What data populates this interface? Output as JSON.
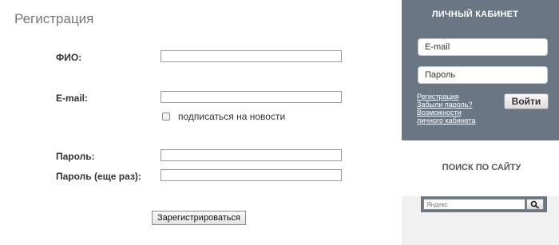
{
  "page": {
    "title": "Регистрация"
  },
  "form": {
    "fio_label": "ФИО:",
    "email_label": "E-mail:",
    "subscribe_label": "подписаться на новости",
    "password_label": "Пароль:",
    "password_repeat_label": "Пароль (еще раз):",
    "submit_label": "Зарегистрироваться"
  },
  "cabinet": {
    "title": "ЛИЧНЫЙ КАБИНЕТ",
    "email_placeholder": "E-mail",
    "password_placeholder": "Пароль",
    "link_register": "Регистрация",
    "link_forgot": "Забыли пароль?",
    "link_features_1": "Возможности",
    "link_features_2": "личного кабинета",
    "login_label": "Войти"
  },
  "search": {
    "title": "ПОИСК ПО САЙТУ",
    "placeholder": "Яндекс",
    "button_icon": "magnifier-icon"
  },
  "colors": {
    "sidebar_accent": "#6b7684",
    "sidebar_bg": "#f1f1f1",
    "title_text": "#777777"
  }
}
